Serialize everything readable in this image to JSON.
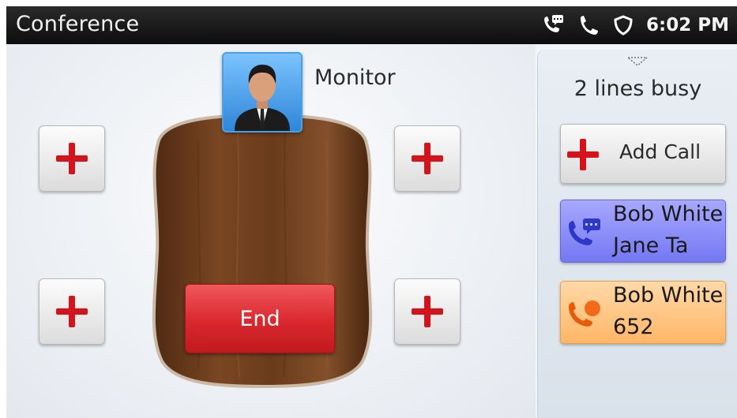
{
  "statusbar": {
    "title": "Conference",
    "time": "6:02 PM",
    "icons": [
      "voicemail-phone-icon",
      "phone-icon",
      "shield-icon"
    ]
  },
  "conference": {
    "participant_label": "Monitor",
    "participant_avatar": "person-avatar-icon",
    "end_label": "End",
    "add_slot_icon": "plus-icon"
  },
  "panel": {
    "busy_text": "2 lines busy",
    "add_call_label": "Add Call",
    "lines": [
      {
        "name": "Bob White",
        "sub": "Jane Ta",
        "color": "#8a8cfa",
        "icon": "conference-call-icon"
      },
      {
        "name": "Bob White",
        "sub": "652",
        "color": "#ffc27a",
        "icon": "call-hold-icon"
      }
    ]
  },
  "colors": {
    "accent_red": "#d4141c",
    "end_red": "#d9282e",
    "table_wood": "#6a3b1e",
    "avatar_blue": "#3d95e6"
  }
}
